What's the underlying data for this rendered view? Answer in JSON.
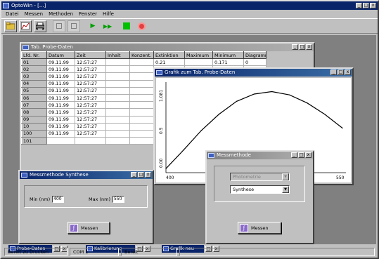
{
  "app": {
    "title": "OptoWin - [...]",
    "window_buttons": [
      "_",
      "□",
      "x"
    ]
  },
  "menu": [
    "Datei",
    "Messen",
    "Methoden",
    "Fenster",
    "Hilfe"
  ],
  "toolbar": {
    "buttons": [
      "open",
      "chart",
      "print",
      "blank1",
      "blank2",
      "play",
      "fast-forward",
      "stop-green",
      "record-red"
    ]
  },
  "table_window": {
    "title": "Tab. Probe-Daten",
    "columns": [
      "Lfd. Nr.",
      "Datum",
      "Zeit",
      "Inhalt",
      "Konzent.",
      "Extinktion",
      "Maximum",
      "Minimum",
      "Diagramm"
    ],
    "rows": [
      [
        "01",
        "09.11.99",
        "12:57:27",
        "",
        "",
        "0.21",
        "",
        "0.171",
        "0"
      ],
      [
        "02",
        "09.11.99",
        "12:57:27",
        "",
        "",
        "",
        "",
        "",
        ""
      ],
      [
        "03",
        "09.11.99",
        "12:57:27",
        "",
        "",
        "",
        "",
        "",
        ""
      ],
      [
        "04",
        "09.11.99",
        "12:57:27",
        "",
        "",
        "",
        "",
        "",
        ""
      ],
      [
        "05",
        "09.11.99",
        "12:57:27",
        "",
        "",
        "",
        "",
        "",
        ""
      ],
      [
        "06",
        "09.11.99",
        "12:57:27",
        "",
        "",
        "",
        "",
        "",
        ""
      ],
      [
        "07",
        "09.11.99",
        "12:57:27",
        "",
        "",
        "",
        "",
        "",
        ""
      ],
      [
        "08",
        "09.11.99",
        "12:57:27",
        "",
        "",
        "",
        "",
        "",
        ""
      ],
      [
        "09",
        "09.11.99",
        "12:57:27",
        "",
        "",
        "",
        "",
        "",
        ""
      ],
      [
        "10",
        "09.11.99",
        "12:57:27",
        "",
        "",
        "",
        "",
        "",
        ""
      ],
      [
        "100",
        "09.11.99",
        "12:57:27",
        "",
        "",
        "",
        "",
        "",
        ""
      ],
      [
        "101",
        "",
        "",
        "",
        "",
        "",
        "",
        "",
        ""
      ]
    ]
  },
  "graph_window": {
    "title": "Grafik zum Tab. Probe-Daten",
    "y_labels": [
      "1.081",
      "0.5",
      "0.00"
    ],
    "x_labels": [
      "400",
      "550"
    ]
  },
  "synth_window": {
    "title": "Messmethode Synthese",
    "min_label": "Min (nm)",
    "min_value": "400",
    "max_label": "Max (nm)",
    "max_value": "550",
    "button_label": "Messen"
  },
  "acq_window": {
    "title": "Messmethode",
    "combo1": "Photometrie",
    "combo2": "Synthese",
    "button_label": "Messen"
  },
  "minimized": [
    {
      "title": "Probe-Daten"
    },
    {
      "title": "Kalibrierung"
    },
    {
      "title": "Grafik neu"
    }
  ],
  "status": [
    "Bereit zu Drucken",
    "COM 1",
    "Bereit",
    ""
  ],
  "chart_data": {
    "type": "line",
    "x": [
      400,
      415,
      430,
      445,
      460,
      475,
      490,
      505,
      520,
      535,
      550
    ],
    "series": [
      {
        "values": [
          0.05,
          0.28,
          0.52,
          0.72,
          0.88,
          0.97,
          1.0,
          0.96,
          0.86,
          0.72,
          0.55
        ]
      }
    ],
    "ylim": [
      0,
      1.1
    ]
  }
}
